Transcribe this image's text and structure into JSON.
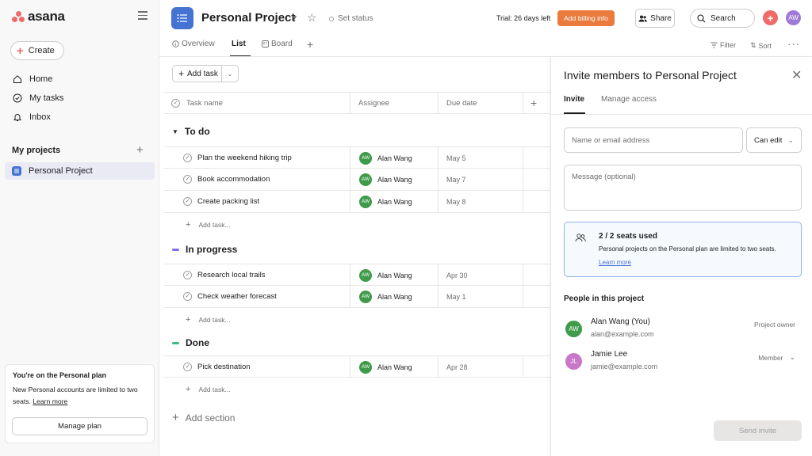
{
  "sidebar": {
    "logo_text": "asana",
    "create_label": "Create",
    "nav": [
      {
        "label": "Home",
        "icon": "home-icon"
      },
      {
        "label": "My tasks",
        "icon": "check-circle-icon"
      },
      {
        "label": "Inbox",
        "icon": "bell-icon"
      }
    ],
    "projects_title": "My projects",
    "project_item": "Personal Project",
    "plan_card": {
      "title": "You're on the Personal plan",
      "text": "New Personal accounts are limited to two seats.",
      "link": "Learn more",
      "button": "Manage plan"
    }
  },
  "header": {
    "project_title": "Personal Project",
    "set_status": "Set status",
    "trial": "Trial: 26 days left",
    "billing_button": "Add billing info",
    "share_button": "Share",
    "search_label": "Search",
    "avatar_initials": "AW"
  },
  "tabs": [
    {
      "label": "Overview",
      "active": false
    },
    {
      "label": "List",
      "active": true
    },
    {
      "label": "Board",
      "active": false
    }
  ],
  "toolbar": {
    "filter": "Filter",
    "sort": "Sort"
  },
  "list": {
    "add_task": "Add task",
    "columns": {
      "name": "Task name",
      "assignee": "Assignee",
      "due": "Due date"
    },
    "groups": [
      {
        "title": "To do",
        "color": "#1e1f21",
        "tasks": [
          {
            "name": "Plan the weekend hiking trip",
            "assignee": "Alan Wang",
            "initials": "AW",
            "due": "May 5"
          },
          {
            "name": "Book accommodation",
            "assignee": "Alan Wang",
            "initials": "AW",
            "due": "May 7"
          },
          {
            "name": "Create packing list",
            "assignee": "Alan Wang",
            "initials": "AW",
            "due": "May 8"
          }
        ]
      },
      {
        "title": "In progress",
        "color": "#7a6ff0",
        "tasks": [
          {
            "name": "Research local trails",
            "assignee": "Alan Wang",
            "initials": "AW",
            "due": "Apr 30"
          },
          {
            "name": "Check weather forecast",
            "assignee": "Alan Wang",
            "initials": "AW",
            "due": "May 1"
          }
        ]
      },
      {
        "title": "Done",
        "color": "#3fb884",
        "tasks": [
          {
            "name": "Pick destination",
            "assignee": "Alan Wang",
            "initials": "AW",
            "due": "Apr 28"
          }
        ]
      }
    ],
    "add_task_inline": "Add task...",
    "add_section": "Add section"
  },
  "invite_panel": {
    "title": "Invite members to Personal Project",
    "tabs": [
      "Invite",
      "Manage access"
    ],
    "email_placeholder": "Name or email address",
    "permission": "Can edit",
    "message_placeholder": "Message (optional)",
    "seats": {
      "title": "2 / 2 seats used",
      "text": "Personal projects on the Personal plan are limited to two seats.",
      "link": "Learn more"
    },
    "people_title": "People in this project",
    "people": [
      {
        "name": "Alan Wang (You)",
        "email": "alan@example.com",
        "role": "Project owner",
        "initials": "AW",
        "color": "#3f9b4a"
      },
      {
        "name": "Jamie Lee",
        "email": "jamie@example.com",
        "role": "Member",
        "initials": "JL",
        "color": "#c977c9"
      }
    ],
    "send_button": "Send invite"
  }
}
